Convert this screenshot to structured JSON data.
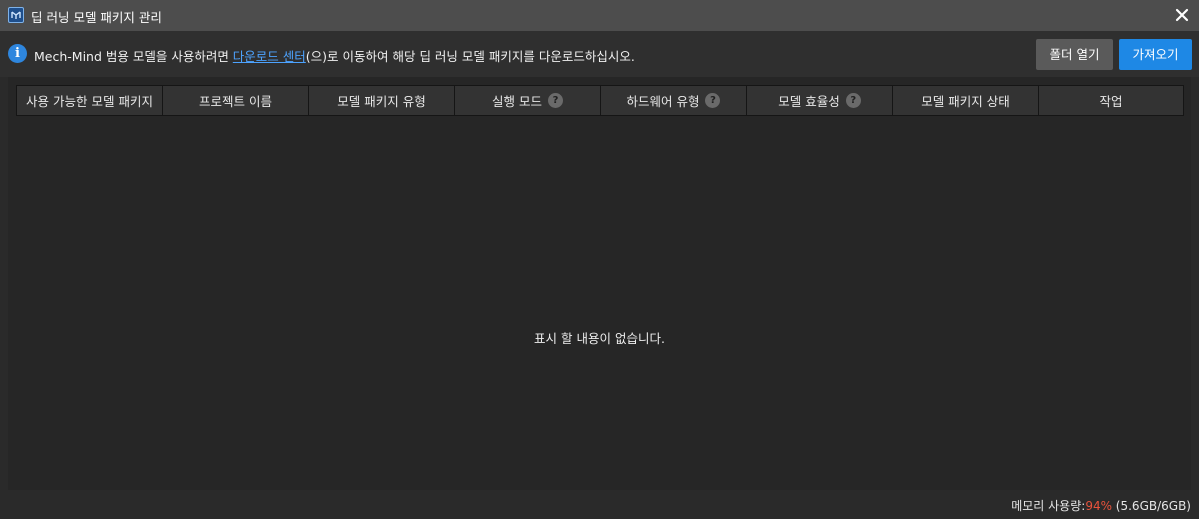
{
  "window": {
    "title": "딥 러닝 모델 패키지 관리",
    "icon": "deep-learning-app-icon",
    "close_icon": "close-icon"
  },
  "info": {
    "icon": "info-icon",
    "text_before": "Mech-Mind 범용 모델을 사용하려면 ",
    "link_text": "다운로드 센터",
    "text_after": "(으)로 이동하여 해당 딥 러닝 모델 패키지를 다운로드하십시오."
  },
  "buttons": {
    "open_folder": "폴더 열기",
    "import": "가져오기"
  },
  "table": {
    "columns": [
      {
        "label": "사용 가능한 모델 패키지",
        "help": false
      },
      {
        "label": "프로젝트 이름",
        "help": false
      },
      {
        "label": "모델 패키지 유형",
        "help": false
      },
      {
        "label": "실행 모드",
        "help": true
      },
      {
        "label": "하드웨어 유형",
        "help": true
      },
      {
        "label": "모델 효율성",
        "help": true
      },
      {
        "label": "모델 패키지 상태",
        "help": false
      },
      {
        "label": "작업",
        "help": false
      }
    ],
    "help_glyph": "?",
    "empty_message": "표시 할 내용이 없습니다."
  },
  "status": {
    "memory_label": "메모리 사용량:",
    "memory_percent": "94%",
    "memory_detail": " (5.6GB/6GB)"
  },
  "colors": {
    "accent": "#1e88e5",
    "link": "#4da3ff",
    "warning": "#e8533c"
  }
}
